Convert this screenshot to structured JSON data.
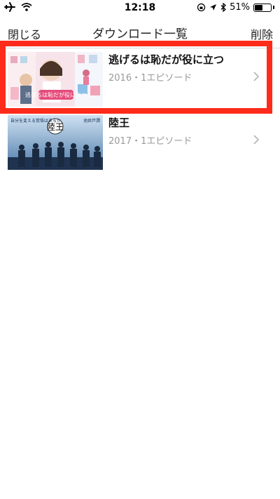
{
  "status_bar": {
    "time": "12:18",
    "battery_text": "51%",
    "battery_level": 0.51,
    "icons": [
      "airplane-icon",
      "wifi-icon",
      "orientation-lock-icon",
      "location-arrow-icon",
      "bluetooth-icon",
      "battery-icon"
    ]
  },
  "nav": {
    "close_label": "閉じる",
    "title": "ダウンロード一覧",
    "delete_label": "削除"
  },
  "downloads": [
    {
      "title": "逃げるは恥だが役に立つ",
      "subtitle": "2016・1エピソード",
      "thumbnail_text": "逃げるは恥だが役に立つ"
    },
    {
      "title": "陸王",
      "subtitle": "2017・1エピソード",
      "thumbnail_text": "陸王",
      "thumbnail_tagline": "自分を変える覚悟はあるか",
      "thumbnail_author": "池井戸潤"
    }
  ],
  "colors": {
    "highlight": "#ff2b1a",
    "subtitle": "#9a9a9a",
    "separator": "#d8d8d8"
  }
}
